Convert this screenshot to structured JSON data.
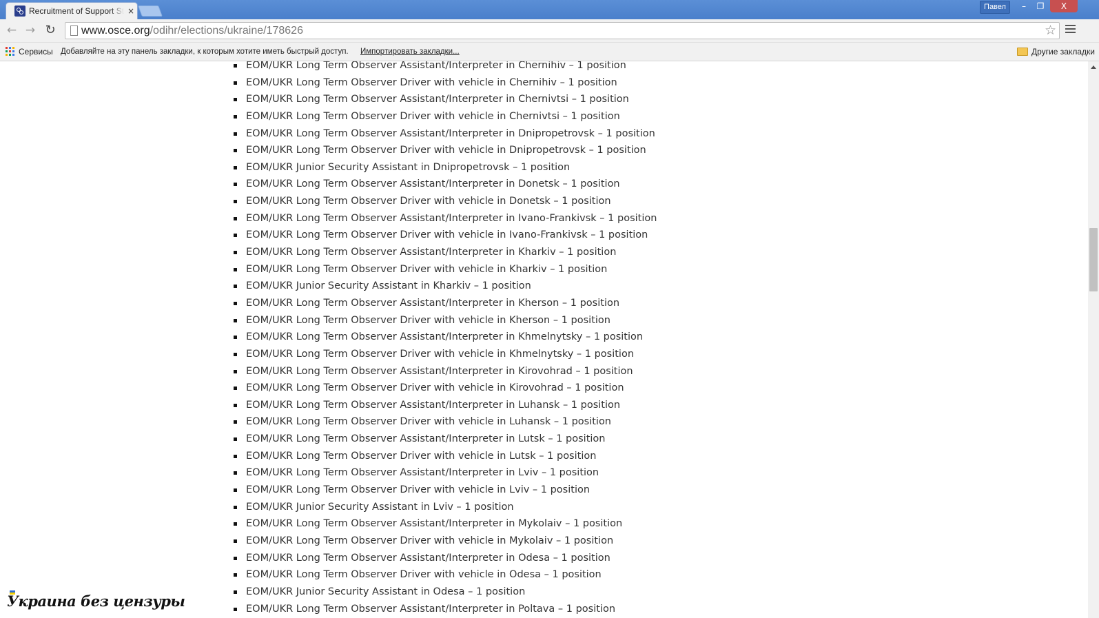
{
  "browser": {
    "tab_title": "Recruitment of Support St",
    "tab_close": "×",
    "user_name": "Павел",
    "controls": {
      "minimize": "–",
      "maximize": "❐",
      "close": "X"
    },
    "url_host": "www.osce.org",
    "url_path": "/odihr/elections/ukraine/178626",
    "icons": {
      "back": "back-arrow-icon",
      "forward": "forward-arrow-icon",
      "reload": "reload-icon",
      "star": "star-icon",
      "menu": "hamburger-menu-icon"
    },
    "colors": {
      "titlebar": "#4a7fcb",
      "apps": [
        "#e33b2e",
        "#3b78e7",
        "#f4b400",
        "#0f9d58",
        "#e33b2e",
        "#3b78e7",
        "#f4b400",
        "#0f9d58",
        "#3b78e7"
      ]
    }
  },
  "bookmarks": {
    "apps_label": "Сервисы",
    "hint": "Добавляйте на эту панель закладки, к которым хотите иметь быстрый доступ.",
    "import_link": "Импортировать закладки...",
    "other_bookmarks": "Другие закладки"
  },
  "jobs": [
    "EOM/UKR Long Term Observer Assistant/Interpreter in Chernihiv – 1 position",
    "EOM/UKR Long Term Observer Driver with vehicle in Chernihiv – 1 position",
    "EOM/UKR Long Term Observer Assistant/Interpreter in Chernivtsi – 1 position",
    "EOM/UKR Long Term Observer Driver with vehicle in Chernivtsi – 1 position",
    "EOM/UKR Long Term Observer Assistant/Interpreter in Dnipropetrovsk – 1 position",
    "EOM/UKR Long Term Observer Driver with vehicle in Dnipropetrovsk – 1 position",
    "EOM/UKR Junior Security Assistant in Dnipropetrovsk – 1 position",
    "EOM/UKR Long Term Observer Assistant/Interpreter in Donetsk – 1 position",
    "EOM/UKR Long Term Observer Driver with vehicle in Donetsk – 1 position",
    "EOM/UKR Long Term Observer Assistant/Interpreter in Ivano-Frankivsk – 1 position",
    "EOM/UKR Long Term Observer Driver with vehicle in Ivano-Frankivsk – 1 position",
    "EOM/UKR Long Term Observer Assistant/Interpreter in Kharkiv – 1 position",
    "EOM/UKR Long Term Observer Driver with vehicle in Kharkiv – 1 position",
    "EOM/UKR Junior Security Assistant in Kharkiv – 1 position",
    "EOM/UKR Long Term Observer Assistant/Interpreter in Kherson – 1 position",
    "EOM/UKR Long Term Observer Driver with vehicle in Kherson – 1 position",
    "EOM/UKR Long Term Observer Assistant/Interpreter in Khmelnytsky – 1 position",
    "EOM/UKR Long Term Observer Driver with vehicle in Khmelnytsky – 1 position",
    "EOM/UKR Long Term Observer Assistant/Interpreter in Kirovohrad – 1 position",
    "EOM/UKR Long Term Observer Driver with vehicle in Kirovohrad – 1 position",
    "EOM/UKR Long Term Observer Assistant/Interpreter in Luhansk – 1 position",
    "EOM/UKR Long Term Observer Driver with vehicle in Luhansk – 1 position",
    "EOM/UKR Long Term Observer Assistant/Interpreter in Lutsk – 1 position",
    "EOM/UKR Long Term Observer Driver with vehicle in Lutsk – 1 position",
    "EOM/UKR Long Term Observer Assistant/Interpreter in Lviv – 1 position",
    "EOM/UKR Long Term Observer Driver with vehicle in Lviv – 1 position",
    "EOM/UKR Junior Security Assistant in Lviv – 1 position",
    "EOM/UKR Long Term Observer Assistant/Interpreter in Mykolaiv – 1 position",
    "EOM/UKR Long Term Observer Driver with vehicle in Mykolaiv – 1 position",
    "EOM/UKR Long Term Observer Assistant/Interpreter in Odesa – 1 position",
    "EOM/UKR Long Term Observer Driver with vehicle in Odesa – 1 position",
    "EOM/UKR Junior Security Assistant in Odesa – 1 position",
    "EOM/UKR Long Term Observer Assistant/Interpreter in Poltava – 1 position"
  ],
  "watermark": {
    "text": "Украина без цензуры",
    "flag_colors": [
      "#2f6fd6",
      "#f5d000"
    ]
  }
}
